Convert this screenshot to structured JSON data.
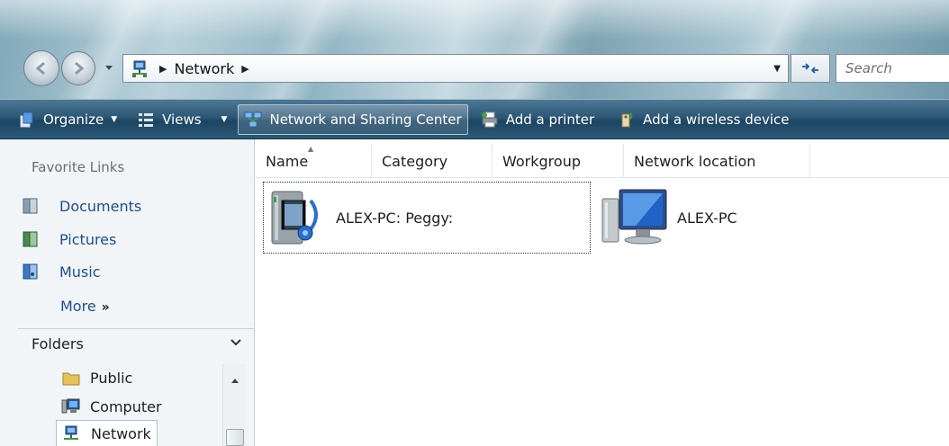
{
  "address": {
    "breadcrumb": "Network",
    "search_placeholder": "Search"
  },
  "toolbar": {
    "organize": "Organize",
    "views": "Views",
    "network_sharing": "Network and Sharing Center",
    "add_printer": "Add a printer",
    "add_wireless": "Add a wireless device"
  },
  "favorites": {
    "title": "Favorite Links",
    "items": [
      "Documents",
      "Pictures",
      "Music"
    ],
    "more": "More"
  },
  "folders": {
    "title": "Folders",
    "items": [
      "Public",
      "Computer",
      "Network"
    ]
  },
  "columns": [
    "Name",
    "Category",
    "Workgroup",
    "Network location"
  ],
  "network_items": [
    {
      "label": "ALEX-PC: Peggy:",
      "icon": "media-server-icon"
    },
    {
      "label": "ALEX-PC",
      "icon": "computer-icon"
    }
  ],
  "colors": {
    "toolbar": "#2c5876",
    "link": "#1e4e8c",
    "glass": "#a9c6d2"
  }
}
